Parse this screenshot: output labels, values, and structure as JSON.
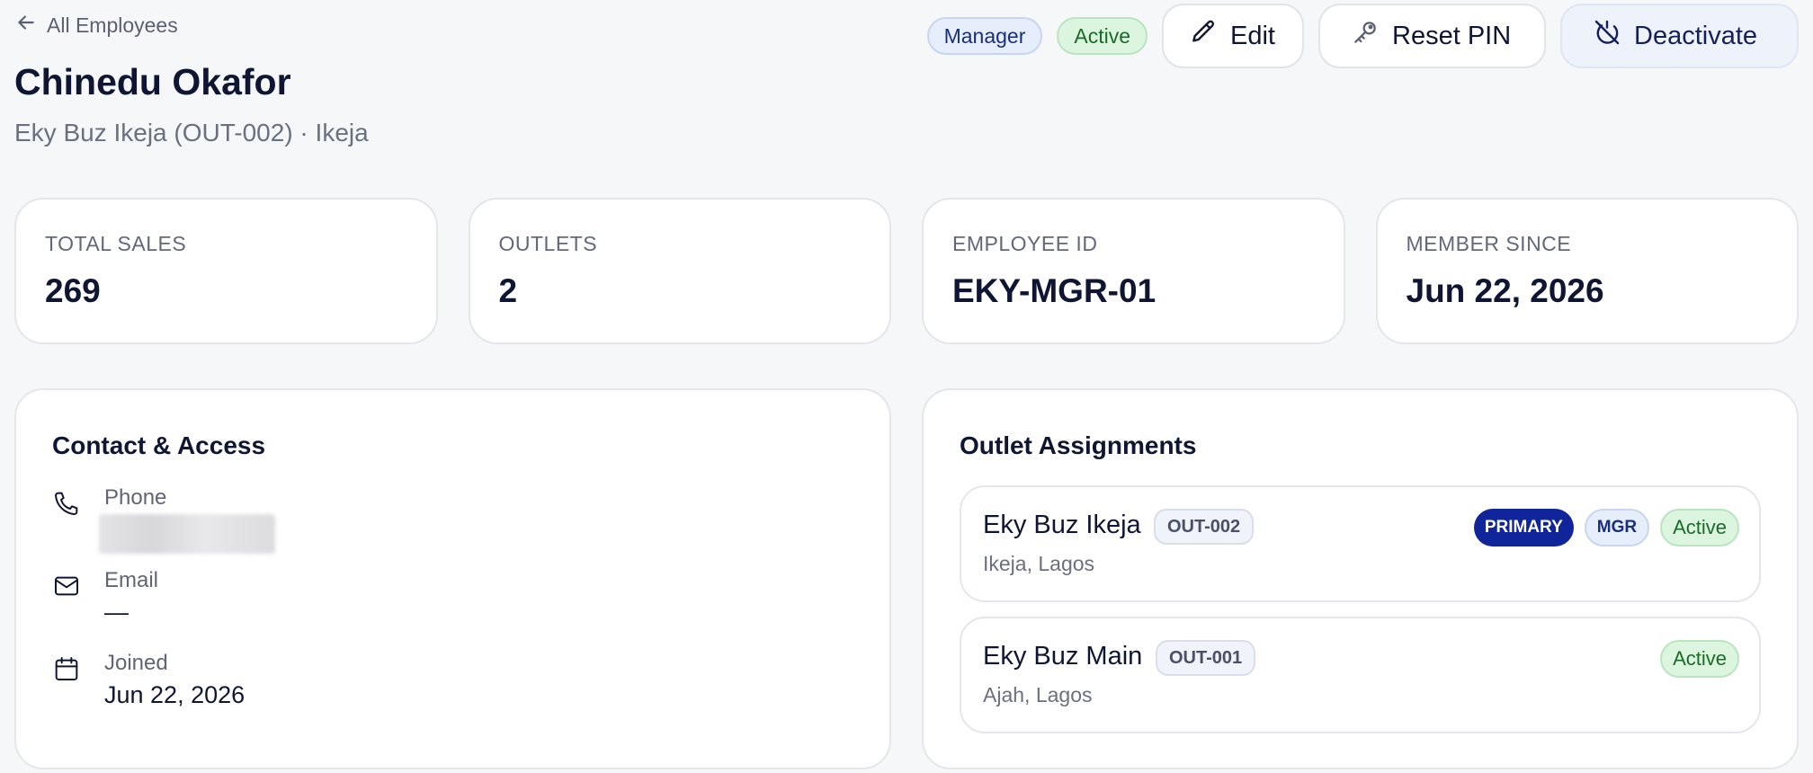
{
  "header": {
    "back_label": "All Employees",
    "name": "Chinedu Okafor",
    "subtitle": "Eky Buz Ikeja (OUT-002) · Ikeja",
    "role_badge": "Manager",
    "status_badge": "Active",
    "edit_label": "Edit",
    "reset_pin_label": "Reset PIN",
    "deactivate_label": "Deactivate"
  },
  "stats": [
    {
      "label": "TOTAL SALES",
      "value": "269"
    },
    {
      "label": "OUTLETS",
      "value": "2"
    },
    {
      "label": "EMPLOYEE ID",
      "value": "EKY-MGR-01"
    },
    {
      "label": "MEMBER SINCE",
      "value": "Jun 22, 2026"
    }
  ],
  "contact": {
    "title": "Contact & Access",
    "phone_label": "Phone",
    "email_label": "Email",
    "email_value": "—",
    "joined_label": "Joined",
    "joined_value": "Jun 22, 2026"
  },
  "outlets": {
    "title": "Outlet Assignments",
    "items": [
      {
        "name": "Eky Buz Ikeja",
        "code": "OUT-002",
        "location": "Ikeja, Lagos",
        "primary_tag": "PRIMARY",
        "role_tag": "MGR",
        "status": "Active"
      },
      {
        "name": "Eky Buz Main",
        "code": "OUT-001",
        "location": "Ajah, Lagos",
        "status": "Active"
      }
    ]
  },
  "icons": {
    "back": "arrow-left-icon",
    "edit": "pencil-icon",
    "reset_pin": "key-icon",
    "deactivate": "power-off-icon",
    "phone": "phone-icon",
    "email": "mail-icon",
    "joined": "calendar-icon"
  },
  "colors": {
    "primary_tag": "#11259a",
    "active_bg": "#dcf5df",
    "active_text": "#1c6b2a"
  }
}
